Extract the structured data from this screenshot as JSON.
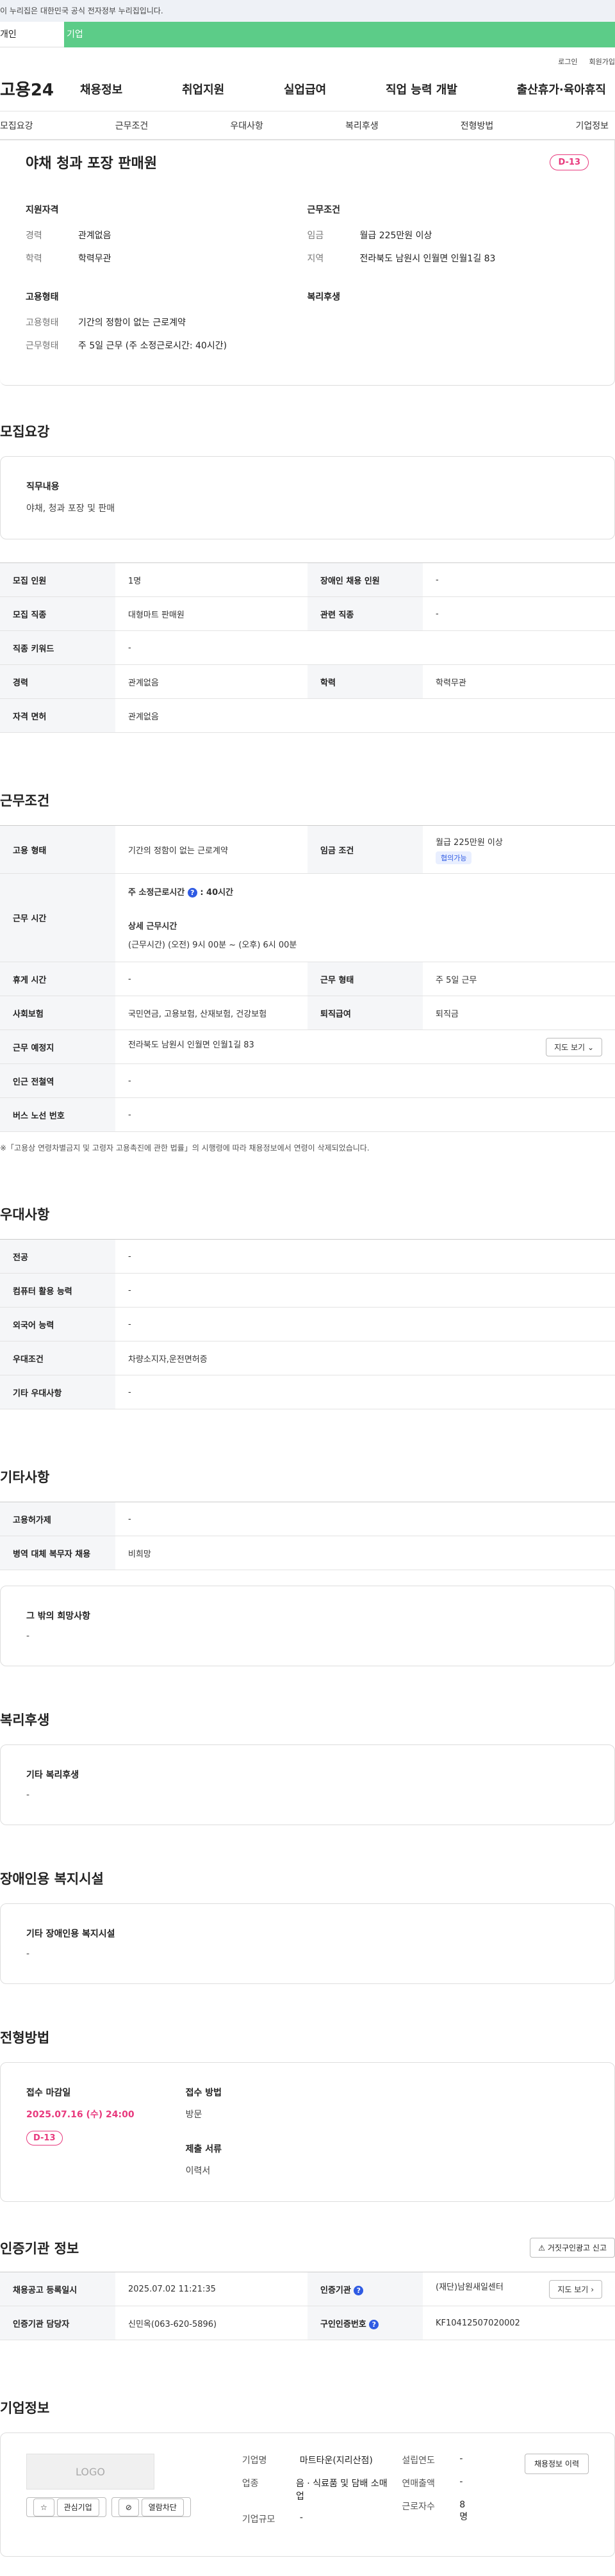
{
  "gov_banner": "이 누리집은 대한민국 공식 전자정부 누리집입니다.",
  "user_tabs": {
    "personal": "개인",
    "company": "기업"
  },
  "top_links": {
    "login": "로그인",
    "signup": "회원가입"
  },
  "logo": "고용24",
  "gnb": [
    "채용정보",
    "취업지원",
    "실업급여",
    "직업 능력 개발",
    "출산휴가·육아휴직"
  ],
  "subnav": [
    "모집요강",
    "근무조건",
    "우대사항",
    "복리후생",
    "전형방법",
    "기업정보"
  ],
  "job": {
    "title": "야채 청과 포장 판매원",
    "dday": "D-13",
    "qual_title": "지원자격",
    "experience_label": "경력",
    "experience": "관계없음",
    "education_label": "학력",
    "education": "학력무관",
    "work_cond_title": "근무조건",
    "wage_label": "임금",
    "wage": "월급 225만원 이상",
    "region_label": "지역",
    "region": "전라북도 남원시 인월면 인월1길 83",
    "emp_title": "고용형태",
    "emp_type_label": "고용형태",
    "emp_type": "기간의 정함이 없는 근로계약",
    "work_type_label": "근무형태",
    "work_type": "주 5일 근무 (주 소정근로시간: 40시간)",
    "welfare_title": "복리후생"
  },
  "recruit": {
    "section": "모집요강",
    "duty_title": "직무내용",
    "duty": "야채, 청과 포장 및 판매",
    "rows": [
      [
        "모집 인원",
        "1명",
        "장애인 채용 인원",
        "-"
      ],
      [
        "모집 직종",
        "대형마트 판매원",
        "관련 직종",
        "-"
      ],
      [
        "직종 키워드",
        "-"
      ],
      [
        "경력",
        "관계없음",
        "학력",
        "학력무관"
      ],
      [
        "자격 면허",
        "관계없음"
      ]
    ]
  },
  "conditions": {
    "section": "근무조건",
    "emp_type_th": "고용 형태",
    "emp_type": "기간의 정함이 없는 근로계약",
    "wage_th": "임금 조건",
    "wage": "월급 225만원 이상",
    "wage_tag": "협의가능",
    "hours_th": "근무 시간",
    "hours_week": "주 소정근로시간",
    "hours_week_val": ": 40시간",
    "hours_detail_title": "상세 근무시간",
    "hours_detail": "(근무시간) (오전) 9시 00분 ~ (오후) 6시 00분",
    "break_th": "휴게 시간",
    "break": "-",
    "form_th": "근무 형태",
    "form": "주 5일 근무",
    "insurance_th": "사회보험",
    "insurance": "국민연금, 고용보험, 산재보험, 건강보험",
    "severance_th": "퇴직급여",
    "severance": "퇴직금",
    "place_th": "근무 예정지",
    "place": "전라북도 남원시 인월면 인월1길 83",
    "map_btn": "지도 보기",
    "station_th": "인근 전철역",
    "station": "-",
    "bus_th": "버스 노선 번호",
    "bus": "-",
    "note": "※「고용상 연령차별금지 및 고령자 고용촉진에 관한 법률」의 시행령에 따라 채용정보에서 연령이 삭제되었습니다."
  },
  "preference": {
    "section": "우대사항",
    "rows": [
      [
        "전공",
        "-"
      ],
      [
        "컴퓨터 활용 능력",
        "-"
      ],
      [
        "외국어 능력",
        "-"
      ],
      [
        "우대조건",
        "차량소지자,운전면허증"
      ],
      [
        "기타 우대사항",
        "-"
      ]
    ]
  },
  "others": {
    "section": "기타사항",
    "rows": [
      [
        "고용허가제",
        "-"
      ],
      [
        "병역 대체 복무자 채용",
        "비희망"
      ]
    ],
    "etc_title": "그 밖의 희망사항",
    "etc": "-"
  },
  "welfare": {
    "section": "복리후생",
    "title": "기타 복리후생",
    "value": "-"
  },
  "disabled": {
    "section": "장애인용 복지시설",
    "title": "기타 장애인용 복지시설",
    "value": "-"
  },
  "selection": {
    "section": "전형방법",
    "deadline_title": "접수 마감일",
    "deadline": "2025.07.16 (수) 24:00",
    "dday": "D-13",
    "method_title": "접수 방법",
    "method": "방문",
    "docs_title": "제출 서류",
    "docs": "이력서"
  },
  "cert": {
    "section": "인증기관 정보",
    "report_btn": "거짓구인광고 신고",
    "reg_th": "채용공고 등록일시",
    "reg": "2025.07.02 11:21:35",
    "agency_th": "인증기관",
    "agency": "(재단)남원새일센터",
    "map_btn": "지도 보기",
    "manager_th": "인증기관 담당자",
    "manager": "신민옥(063-620-5896)",
    "offer_th": "구인인증번호",
    "offer": "KF10412507020002"
  },
  "company": {
    "section": "기업정보",
    "logo": "LOGO",
    "interest_btn": "관심기업",
    "block_btn": "열람차단",
    "name_label": "기업명",
    "name": "마트타운(지리산점)",
    "industry_label": "업종",
    "industry": "음 · 식료품 및 담배 소매업",
    "size_label": "기업규모",
    "size": "-",
    "founded_label": "설립연도",
    "founded": "-",
    "sales_label": "연매출액",
    "sales": "-",
    "employees_label": "근로자수",
    "employees": "8명",
    "history_btn": "채용정보 이력"
  }
}
